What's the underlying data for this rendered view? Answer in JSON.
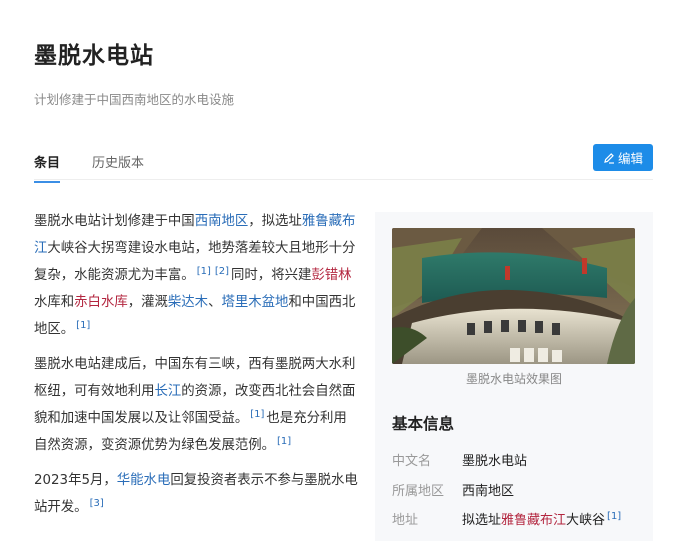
{
  "page": {
    "title": "墨脱水电站",
    "subtitle": "计划修建于中国西南地区的水电设施"
  },
  "tabs": [
    {
      "label": "条目",
      "active": true
    },
    {
      "label": "历史版本",
      "active": false
    }
  ],
  "edit_button": {
    "label": "编辑",
    "icon": "pen-icon",
    "color": "#1d8ce8"
  },
  "article": {
    "p1": {
      "t1": "墨脱水电站计划修建于中国",
      "l1": "西南地区",
      "t2": "，拟选址",
      "l2": "雅鲁藏布江",
      "t3": "大峡谷大拐弯建设水电站，地势落差较大且地形十分复杂，水能资源尤为丰富。",
      "r1": "[1]",
      "r2": "[2]",
      "t4": "同时，将兴建",
      "l3": "彭错林",
      "t5": "水库和",
      "l4": "赤白水库",
      "t6": "，灌溉",
      "l5": "柴达木",
      "t7": "、",
      "l6": "塔里木盆地",
      "t8": "和中国西北地区。",
      "r3": "[1]"
    },
    "p2": {
      "t1": "墨脱水电站建成后，中国东有三峡，西有墨脱两大水利枢纽，可有效地利用",
      "l1": "长江",
      "t2": "的资源，改变西北社会自然面貌和加速中国发展以及让邻国受益。",
      "r1": "[1]",
      "t3": "也是充分利用自然资源，变资源优势为绿色发展范例。",
      "r2": "[1]"
    },
    "p3": {
      "t1": "2023年5月，",
      "l1": "华能水电",
      "t2": "回复投资者表示不参与墨脱水电站开发。",
      "r1": "[3]"
    }
  },
  "infobox": {
    "image_caption": "墨脱水电站效果图",
    "heading": "基本信息",
    "rows": [
      {
        "key": "中文名",
        "value": "墨脱水电站"
      },
      {
        "key": "所属地区",
        "value": "西南地区"
      },
      {
        "key": "地址",
        "value_prefix": "拟选址",
        "value_link": "雅鲁藏布江",
        "value_suffix": "大峡谷",
        "ref": "[1]"
      }
    ]
  },
  "colors": {
    "link": "#2a6db8",
    "link_red": "#b3263f",
    "accent": "#1d8ce8"
  }
}
